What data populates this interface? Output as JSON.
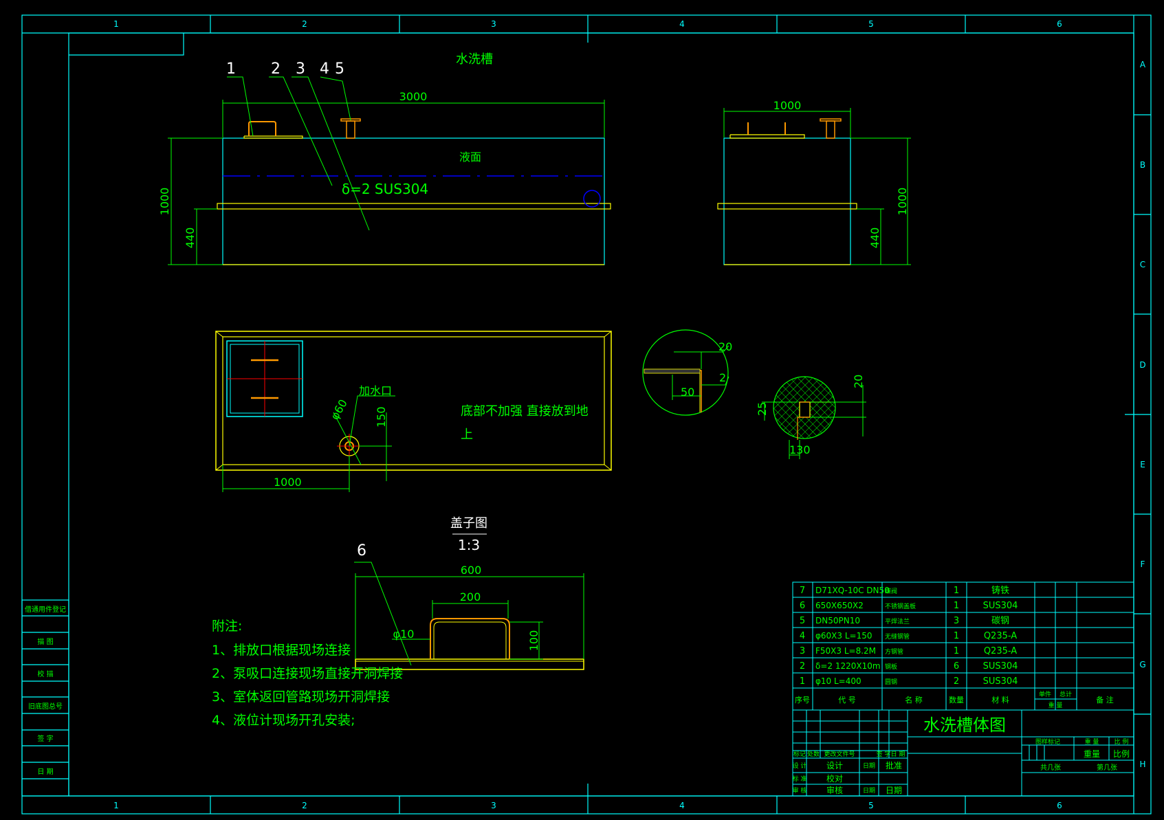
{
  "colors": {
    "background": "#000000",
    "frame": "#00ffff",
    "dimension": "#00ff00",
    "outline": "#ffff00",
    "part": "#ff9900",
    "liquid": "#0000ff",
    "center": "#ff0000",
    "text_white": "#ffffff"
  },
  "border": {
    "columns": [
      "1",
      "2",
      "3",
      "4",
      "5",
      "6"
    ],
    "rows": [
      "A",
      "B",
      "C",
      "D",
      "E",
      "F",
      "G",
      "H"
    ]
  },
  "title_main": "水洗槽",
  "front_view": {
    "callouts": [
      "1",
      "2",
      "3",
      "4",
      "5"
    ],
    "width": "3000",
    "height": "1000",
    "base_height": "440",
    "liquid_label": "液面",
    "plate_label": "δ=2   SUS304"
  },
  "side_view": {
    "width": "1000",
    "height": "1000",
    "base_height": "440"
  },
  "plan_view": {
    "inlet_label": "加水口",
    "inlet_dia": "φ60",
    "inlet_offset": "150",
    "inlet_position": "1000",
    "note_line1": "底部不加强    直接放到地",
    "note_line2": "上"
  },
  "detail_1": {
    "dim_a": "20",
    "dim_b": "2",
    "dim_c": "50"
  },
  "detail_2": {
    "dim_a": "20",
    "dim_b": "25",
    "dim_c": "130"
  },
  "lid_view": {
    "title": "盖子图",
    "scale": "1:3",
    "callout": "6",
    "width": "600",
    "handle_width": "200",
    "handle_height": "100",
    "rod": "φ10"
  },
  "notes": {
    "heading": "附注:",
    "items": [
      "1、排放口根据现场连接",
      "2、泵吸口连接现场直接开洞焊接",
      "3、室体返回管路现场开洞焊接",
      "4、液位计现场开孔安装;"
    ]
  },
  "left_strip": [
    "借通用件登记",
    "描 图",
    "校 描",
    "旧底图总号",
    "签 字",
    "日 期"
  ],
  "bom": {
    "rows": [
      {
        "no": "7",
        "code": "D71XQ-10C DN50",
        "name": "蝶阀",
        "qty": "1",
        "material": "铸铁"
      },
      {
        "no": "6",
        "code": "650X650X2",
        "name": "不锈钢盖板",
        "qty": "1",
        "material": "SUS304"
      },
      {
        "no": "5",
        "code": "DN50PN10",
        "name": "平焊法兰",
        "qty": "3",
        "material": "碳钢"
      },
      {
        "no": "4",
        "code": "φ60X3 L=150",
        "name": "无缝钢管",
        "qty": "1",
        "material": "Q235-A"
      },
      {
        "no": "3",
        "code": "F50X3 L=8.2M",
        "name": "方钢管",
        "qty": "1",
        "material": "Q235-A"
      },
      {
        "no": "2",
        "code": "δ=2  1220X10m",
        "name": "钢板",
        "qty": "6",
        "material": "SUS304"
      },
      {
        "no": "1",
        "code": "φ10 L=400",
        "name": "圆钢",
        "qty": "2",
        "material": "SUS304"
      }
    ],
    "header": {
      "no": "序号",
      "code": "代 号",
      "name": "名 称",
      "qty": "数量",
      "material": "材 料",
      "unit_weight": "单件",
      "total_weight": "总计",
      "weight": "重 量",
      "remark": "备 注"
    }
  },
  "title_block": {
    "drawing_name": "水洗槽体图",
    "revision_row": [
      "标记",
      "处数",
      "更改文件号",
      "签 字",
      "日 期"
    ],
    "sign_rows": [
      [
        "设 计",
        "设计",
        "日期",
        "批准"
      ],
      [
        "标 准",
        "校对"
      ],
      [
        "审 核",
        "审核",
        "日期",
        "日期"
      ]
    ],
    "stage_label": "图样标记",
    "weight_label": "重 量",
    "scale_label": "比 例",
    "sheet_left": "共几张",
    "sheet_right": "第几张",
    "weight_cell": "重量",
    "scale_cell": "比例"
  }
}
